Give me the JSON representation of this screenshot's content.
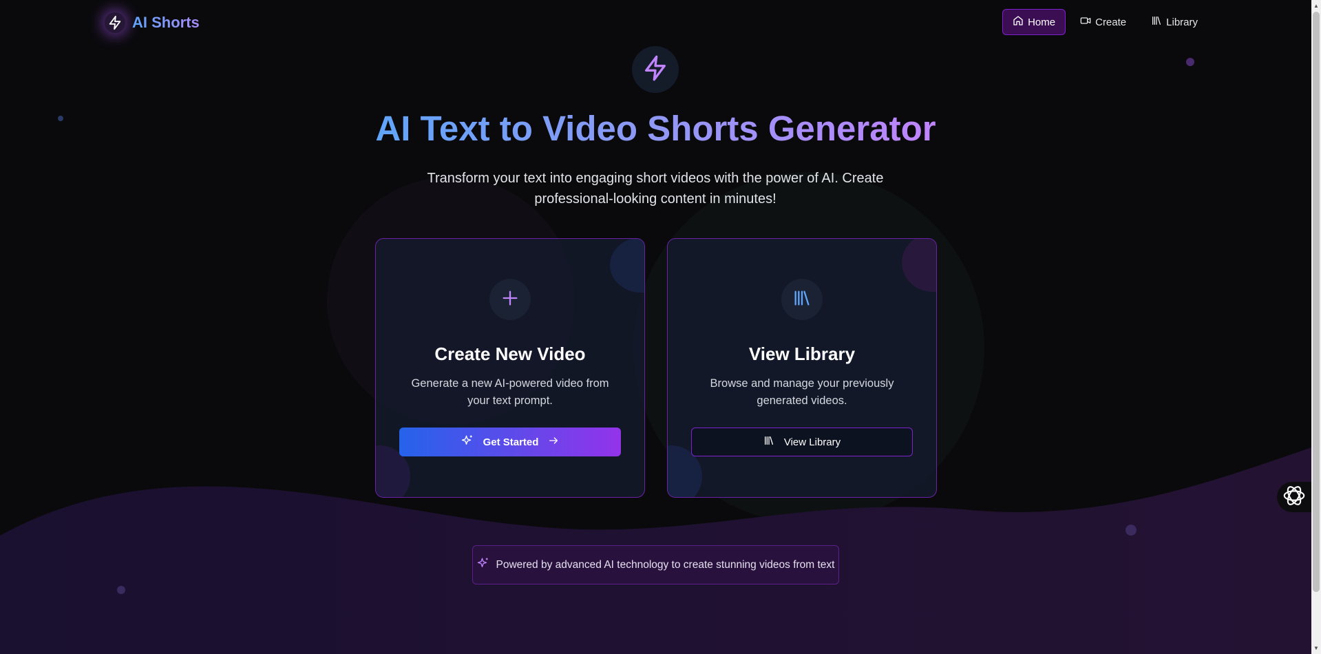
{
  "brand": {
    "name": "AI Shorts",
    "icon": "lightning-bolt-icon"
  },
  "nav": {
    "items": [
      {
        "label": "Home",
        "icon": "home-icon",
        "active": true
      },
      {
        "label": "Create",
        "icon": "video-camera-icon",
        "active": false
      },
      {
        "label": "Library",
        "icon": "library-icon",
        "active": false
      }
    ]
  },
  "hero": {
    "icon": "lightning-bolt-icon",
    "title": "AI Text to Video Shorts Generator",
    "subtitle": "Transform your text into engaging short videos with the power of AI. Create professional-looking content in minutes!"
  },
  "cards": [
    {
      "icon": "plus-icon",
      "title": "Create New Video",
      "description": "Generate a new AI-powered video from your text prompt.",
      "button_label": "Get Started",
      "button_icon": "sparkles-icon",
      "button_trailing_icon": "arrow-right-icon"
    },
    {
      "icon": "library-icon",
      "title": "View Library",
      "description": "Browse and manage your previously generated videos.",
      "button_label": "View Library",
      "button_icon": "library-icon"
    }
  ],
  "footer_badge": {
    "icon": "sparkles-icon",
    "text": "Powered by advanced AI technology to create stunning videos from text"
  },
  "assistant": {
    "icon": "openai-logo-icon"
  },
  "colors": {
    "background": "#0a0a0c",
    "accent_blue": "#60a5fa",
    "accent_purple": "#a855f7",
    "card_border": "#6b21a8",
    "nav_active_bg": "#3b0d52"
  }
}
